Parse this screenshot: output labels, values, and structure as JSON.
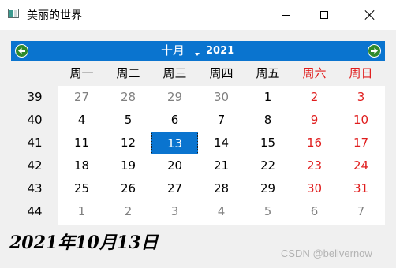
{
  "window": {
    "title": "美丽的世界",
    "icon": "app-window-icon",
    "controls": [
      "minimize-icon",
      "maximize-icon",
      "close-icon"
    ]
  },
  "calendar": {
    "month_label": "十月",
    "year_label": "2021",
    "prev_icon": "arrow-left-icon",
    "next_icon": "arrow-right-icon",
    "accent_color": "#0a74cf",
    "weekend_color": "#e01d1d",
    "nav_arrow_color": "#2f8a2c",
    "weekdays": [
      "周一",
      "周二",
      "周三",
      "周四",
      "周五",
      "周六",
      "周日"
    ],
    "weeks": [
      {
        "num": "39",
        "days": [
          "27",
          "28",
          "29",
          "30",
          "1",
          "2",
          "3"
        ]
      },
      {
        "num": "40",
        "days": [
          "4",
          "5",
          "6",
          "7",
          "8",
          "9",
          "10"
        ]
      },
      {
        "num": "41",
        "days": [
          "11",
          "12",
          "13",
          "14",
          "15",
          "16",
          "17"
        ]
      },
      {
        "num": "42",
        "days": [
          "18",
          "19",
          "20",
          "21",
          "22",
          "23",
          "24"
        ]
      },
      {
        "num": "43",
        "days": [
          "25",
          "26",
          "27",
          "28",
          "29",
          "30",
          "31"
        ]
      },
      {
        "num": "44",
        "days": [
          "1",
          "2",
          "3",
          "4",
          "5",
          "6",
          "7"
        ]
      }
    ],
    "selected_day": "13"
  },
  "date_label": "2021年10月13日",
  "watermark": "CSDN @belivernow"
}
